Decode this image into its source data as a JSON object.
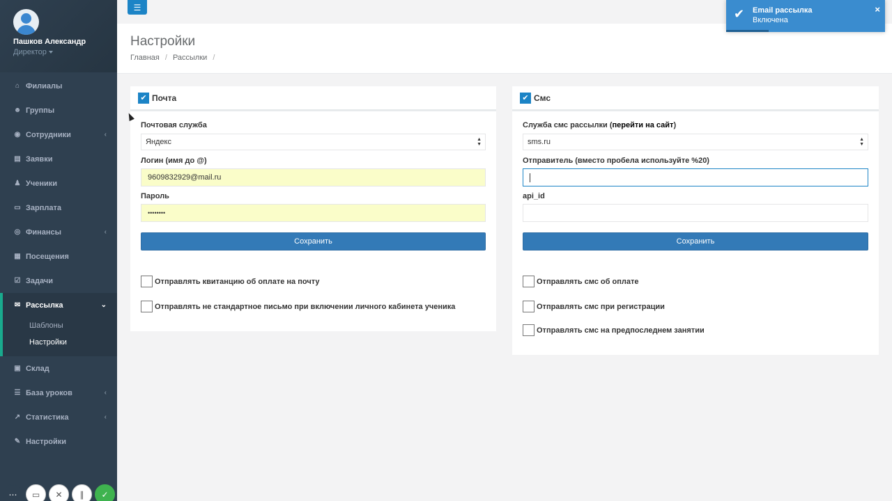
{
  "profile": {
    "name": "Пашков Александр",
    "role": "Директор"
  },
  "sidebar": {
    "items": [
      {
        "label": "Филиалы",
        "icon": "bank-icon",
        "glyph": "⌂",
        "arrow": ""
      },
      {
        "label": "Группы",
        "icon": "users-icon",
        "glyph": "☻",
        "arrow": ""
      },
      {
        "label": "Сотрудники",
        "icon": "user-circle-icon",
        "glyph": "◉",
        "arrow": "‹"
      },
      {
        "label": "Заявки",
        "icon": "book-icon",
        "glyph": "▤",
        "arrow": ""
      },
      {
        "label": "Ученики",
        "icon": "user-icon",
        "glyph": "♟",
        "arrow": ""
      },
      {
        "label": "Зарплата",
        "icon": "credit-card-icon",
        "glyph": "▭",
        "arrow": ""
      },
      {
        "label": "Финансы",
        "icon": "money-icon",
        "glyph": "◎",
        "arrow": "‹"
      },
      {
        "label": "Посещения",
        "icon": "calendar-icon",
        "glyph": "▦",
        "arrow": ""
      },
      {
        "label": "Задачи",
        "icon": "tasks-icon",
        "glyph": "☑",
        "arrow": ""
      }
    ],
    "active": {
      "label": "Рассылка",
      "icon": "envelope-icon",
      "glyph": "✉",
      "arrow": "⌄"
    },
    "sub_items": [
      {
        "label": "Шаблоны"
      },
      {
        "label": "Настройки"
      }
    ],
    "items_after": [
      {
        "label": "Склад",
        "icon": "archive-icon",
        "glyph": "▣",
        "arrow": ""
      },
      {
        "label": "База уроков",
        "icon": "database-icon",
        "glyph": "☰",
        "arrow": "‹"
      },
      {
        "label": "Статистика",
        "icon": "line-chart-icon",
        "glyph": "↗",
        "arrow": "‹"
      },
      {
        "label": "Настройки",
        "icon": "wrench-icon",
        "glyph": "✎",
        "arrow": ""
      }
    ]
  },
  "page": {
    "title": "Настройки",
    "breadcrumb": [
      "Главная",
      "Рассылки"
    ]
  },
  "mail_panel": {
    "title": "Почта",
    "service_label": "Почтовая служба",
    "service_value": "Яндекс",
    "login_label": "Логин (имя до @)",
    "login_value": "9609832929@mail.ru",
    "password_label": "Пароль",
    "password_value": "••••••••",
    "save_label": "Сохранить",
    "checks": [
      "Отправлять квитанцию об оплате на почту",
      "Отправлять не стандартное письмо при включении личного кабинета ученика"
    ]
  },
  "sms_panel": {
    "title": "Смс",
    "service_label_prefix": "Служба смс рассылки (",
    "service_label_link": "перейти на сайт",
    "service_label_suffix": ")",
    "service_value": "sms.ru",
    "sender_label": "Отправитель (вместо пробела используйте %20)",
    "sender_value": "",
    "api_label": "api_id",
    "api_value": "",
    "save_label": "Сохранить",
    "checks": [
      "Отправлять смс об оплате",
      "Отправлять смс при регистрации",
      "Отправлять смс на предпоследнем занятии"
    ]
  },
  "toast": {
    "title": "Email рассылка",
    "message": "Включена",
    "close": "×"
  },
  "colors": {
    "sidebar": "#2f4050",
    "accent": "#1c84c6",
    "button": "#337ab7",
    "toast": "#3a8ccf"
  }
}
